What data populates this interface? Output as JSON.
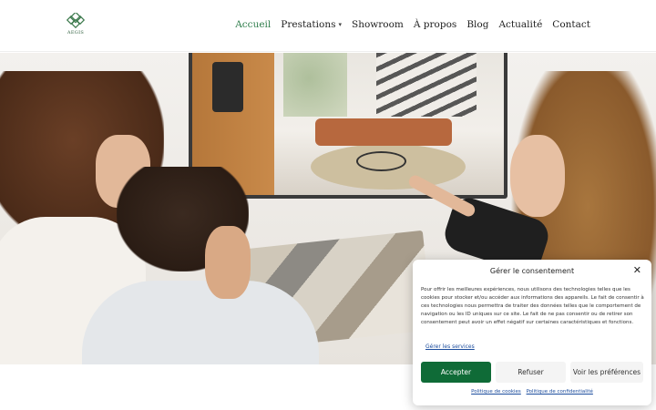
{
  "brand": {
    "logo_text": "AEGIS",
    "accent": "#2e7d4b",
    "logo_color": "#2f5f3e"
  },
  "nav": {
    "items": [
      {
        "label": "Accueil",
        "active": true
      },
      {
        "label": "Prestations",
        "dropdown": true
      },
      {
        "label": "Showroom"
      },
      {
        "label": "À propos"
      },
      {
        "label": "Blog"
      },
      {
        "label": "Actualité"
      },
      {
        "label": "Contact"
      }
    ]
  },
  "consent": {
    "title": "Gérer le consentement",
    "text": "Pour offrir les meilleures expériences, nous utilisons des technologies telles que les cookies pour stocker et/ou accéder aux informations des appareils. Le fait de consentir à ces technologies nous permettra de traiter des données telles que le comportement de navigation ou les ID uniques sur ce site. Le fait de ne pas consentir ou de retirer son consentement peut avoir un effet négatif sur certaines caractéristiques et fonctions.",
    "manage_link": "Gérer les services",
    "accept": "Accepter",
    "refuse": "Refuser",
    "preferences": "Voir les préférences",
    "cookie_policy": "Politique de cookies",
    "privacy_policy": "Politique de confidentialité",
    "accept_color": "#0f6b37"
  }
}
